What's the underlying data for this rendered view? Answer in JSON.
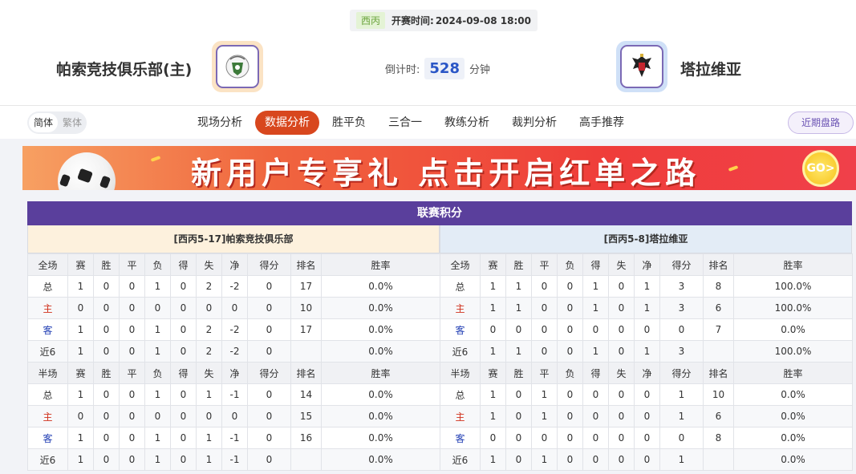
{
  "match": {
    "league": "西丙",
    "kickoff_label": "开赛时间:",
    "kickoff_time": "2024-09-08 18:00",
    "countdown_label": "倒计时:",
    "countdown_value": "528",
    "countdown_unit": "分钟"
  },
  "home": {
    "name": "帕索竞技俱乐部(主)"
  },
  "away": {
    "name": "塔拉维亚"
  },
  "lang": {
    "simplified": "简体",
    "traditional": "繁体"
  },
  "nav": {
    "items": [
      "现场分析",
      "数据分析",
      "胜平负",
      "三合一",
      "教练分析",
      "裁判分析",
      "高手推荐"
    ],
    "recent": "近期盘路"
  },
  "banner": {
    "text": "新用户专享礼 点击开启红单之路",
    "go": "GO>"
  },
  "standings": {
    "title": "联赛积分",
    "home_header": "[西丙5-17]帕索竞技俱乐部",
    "away_header": "[西丙5-8]塔拉维亚",
    "columns": [
      "赛",
      "胜",
      "平",
      "负",
      "得",
      "失",
      "净",
      "得分",
      "排名",
      "胜率"
    ],
    "full_label": "全场",
    "half_label": "半场",
    "home_full": [
      [
        "总",
        "1",
        "0",
        "0",
        "1",
        "0",
        "2",
        "-2",
        "0",
        "17",
        "0.0%"
      ],
      [
        "主",
        "0",
        "0",
        "0",
        "0",
        "0",
        "0",
        "0",
        "0",
        "10",
        "0.0%"
      ],
      [
        "客",
        "1",
        "0",
        "0",
        "1",
        "0",
        "2",
        "-2",
        "0",
        "17",
        "0.0%"
      ],
      [
        "近6",
        "1",
        "0",
        "0",
        "1",
        "0",
        "2",
        "-2",
        "0",
        "",
        "0.0%"
      ]
    ],
    "home_half": [
      [
        "总",
        "1",
        "0",
        "0",
        "1",
        "0",
        "1",
        "-1",
        "0",
        "14",
        "0.0%"
      ],
      [
        "主",
        "0",
        "0",
        "0",
        "0",
        "0",
        "0",
        "0",
        "0",
        "15",
        "0.0%"
      ],
      [
        "客",
        "1",
        "0",
        "0",
        "1",
        "0",
        "1",
        "-1",
        "0",
        "16",
        "0.0%"
      ],
      [
        "近6",
        "1",
        "0",
        "0",
        "1",
        "0",
        "1",
        "-1",
        "0",
        "",
        "0.0%"
      ]
    ],
    "away_full": [
      [
        "总",
        "1",
        "1",
        "0",
        "0",
        "1",
        "0",
        "1",
        "3",
        "8",
        "100.0%"
      ],
      [
        "主",
        "1",
        "1",
        "0",
        "0",
        "1",
        "0",
        "1",
        "3",
        "6",
        "100.0%"
      ],
      [
        "客",
        "0",
        "0",
        "0",
        "0",
        "0",
        "0",
        "0",
        "0",
        "7",
        "0.0%"
      ],
      [
        "近6",
        "1",
        "1",
        "0",
        "0",
        "1",
        "0",
        "1",
        "3",
        "",
        "100.0%"
      ]
    ],
    "away_half": [
      [
        "总",
        "1",
        "0",
        "1",
        "0",
        "0",
        "0",
        "0",
        "1",
        "10",
        "0.0%"
      ],
      [
        "主",
        "1",
        "0",
        "1",
        "0",
        "0",
        "0",
        "0",
        "1",
        "6",
        "0.0%"
      ],
      [
        "客",
        "0",
        "0",
        "0",
        "0",
        "0",
        "0",
        "0",
        "0",
        "8",
        "0.0%"
      ],
      [
        "近6",
        "1",
        "0",
        "1",
        "0",
        "0",
        "0",
        "0",
        "1",
        "",
        "0.0%"
      ]
    ]
  }
}
